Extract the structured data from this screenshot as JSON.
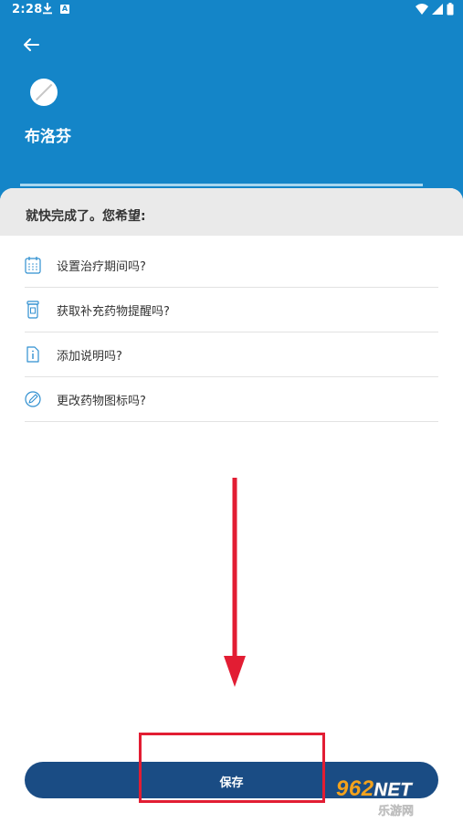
{
  "status_bar": {
    "time": "2:28",
    "icons": [
      "download-icon",
      "a-badge-icon",
      "wifi-icon",
      "signal-icon",
      "battery-icon"
    ],
    "a_badge": "A"
  },
  "header": {
    "back_icon": "arrow-left-icon",
    "pill_icon": "pill-icon",
    "medication_name": "布洛芬",
    "background_color": "#1485c8"
  },
  "card": {
    "title": "就快完成了。您希望:",
    "options": [
      {
        "icon": "calendar-icon",
        "label": "设置治疗期间吗?"
      },
      {
        "icon": "pill-bottle-icon",
        "label": "获取补充药物提醒吗?"
      },
      {
        "icon": "note-info-icon",
        "label": "添加说明吗?"
      },
      {
        "icon": "edit-icon",
        "label": "更改药物图标吗?"
      }
    ]
  },
  "save_button": {
    "label": "保存",
    "color": "#1a4c84"
  },
  "annotation": {
    "color": "#e21d33"
  },
  "watermark": {
    "main": "962",
    "suffix": "NET",
    "sub": "乐游网"
  }
}
